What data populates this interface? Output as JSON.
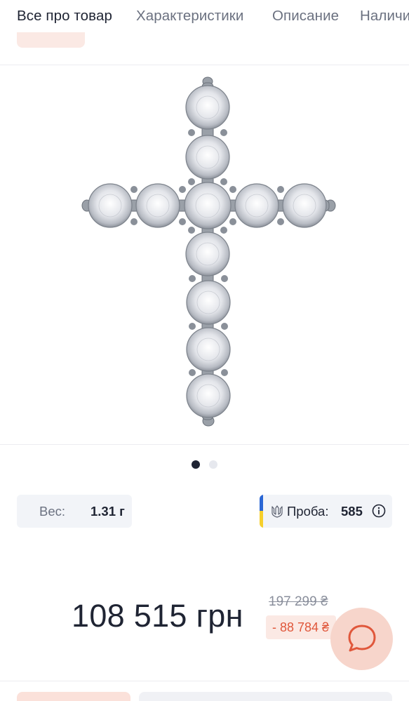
{
  "tabs": [
    {
      "label": "Все про товар",
      "active": true
    },
    {
      "label": "Характеристики",
      "active": false
    },
    {
      "label": "Описание",
      "active": false
    },
    {
      "label": "Наличи",
      "active": false
    }
  ],
  "gallery": {
    "image": "diamond-cross-pendant",
    "slides_total": 2,
    "active_slide": 1
  },
  "specs": {
    "weight_label": "Вес:",
    "weight_value": "1.31 г",
    "probe_label": "Проба:",
    "probe_value": "585",
    "probe_icons": [
      "ukraine-flag",
      "trident-icon",
      "info-icon"
    ]
  },
  "pricing": {
    "current_price": "108 515 грн",
    "old_price": "197 299 ₴",
    "discount": "- 88 784 ₴"
  },
  "colors": {
    "text_primary": "#1f2433",
    "text_secondary": "#6b7180",
    "accent_pink_bg": "#fbe9e4",
    "discount_red": "#e0573b",
    "chat_button_bg": "#f7d5cb",
    "chat_icon": "#e0573b",
    "pill_bg": "#f2f4f8"
  },
  "icons": [
    "chat-bubble-icon"
  ]
}
